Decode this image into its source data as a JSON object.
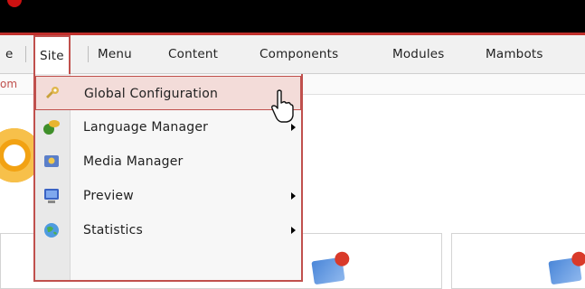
{
  "menubar": {
    "items": [
      {
        "label": "e"
      },
      {
        "label": "Site"
      },
      {
        "label": "Menu"
      },
      {
        "label": "Content"
      },
      {
        "label": "Components"
      },
      {
        "label": "Modules"
      },
      {
        "label": "Mambots"
      }
    ]
  },
  "subbar": {
    "fragment": "om"
  },
  "dropdown": {
    "items": [
      {
        "label": "Global Configuration",
        "icon": "wrench-icon"
      },
      {
        "label": "Language Manager",
        "icon": "language-icon"
      },
      {
        "label": "Media Manager",
        "icon": "media-icon"
      },
      {
        "label": "Preview",
        "icon": "monitor-icon"
      },
      {
        "label": "Statistics",
        "icon": "globe-icon"
      }
    ]
  },
  "colors": {
    "accent": "#c0504d",
    "topbar": "#000000",
    "menubar": "#f1f1f1",
    "hover": "#f3dcd9"
  }
}
